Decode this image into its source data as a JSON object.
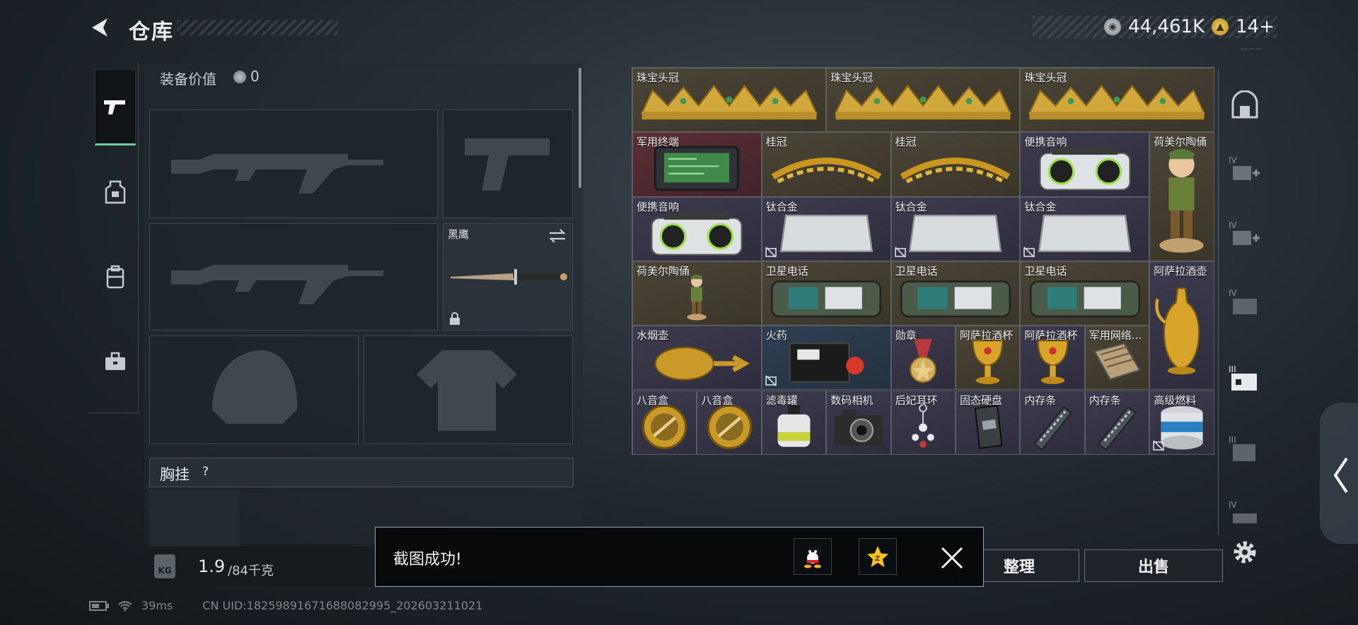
{
  "header": {
    "title": "仓库",
    "currency_silver": "44,461K",
    "currency_gold": "14+"
  },
  "version_text": "———",
  "equipment": {
    "value_label": "装备价值",
    "value": "0",
    "knife_slot_label": "黑鹰",
    "chest_label": "胸挂",
    "chest_help": "?",
    "weight_icon_text": "KG",
    "weight_current": "1.9",
    "weight_max": "/84千克"
  },
  "grid_items": [
    {
      "name": "珠宝头冠",
      "rarity": "gold",
      "icon": "crown-icon"
    },
    {
      "name": "珠宝头冠",
      "rarity": "gold",
      "icon": "crown-icon"
    },
    {
      "name": "珠宝头冠",
      "rarity": "gold",
      "icon": "crown-icon"
    },
    {
      "name": "军用终端",
      "rarity": "red",
      "icon": "terminal-icon"
    },
    {
      "name": "桂冠",
      "rarity": "gold",
      "icon": "laurel-icon"
    },
    {
      "name": "桂冠",
      "rarity": "gold",
      "icon": "laurel-icon"
    },
    {
      "name": "便携音响",
      "rarity": "purple",
      "icon": "speaker-icon"
    },
    {
      "name": "荷美尔陶俑",
      "rarity": "gold",
      "icon": "figurine-icon"
    },
    {
      "name": "便携音响",
      "rarity": "purple",
      "icon": "speaker-icon"
    },
    {
      "name": "钛合金",
      "rarity": "purple",
      "icon": "alloy-icon"
    },
    {
      "name": "钛合金",
      "rarity": "purple",
      "icon": "alloy-icon"
    },
    {
      "name": "钛合金",
      "rarity": "purple",
      "icon": "alloy-icon"
    },
    {
      "name": "荷美尔陶俑",
      "rarity": "gold",
      "icon": "figurine-icon"
    },
    {
      "name": "卫星电话",
      "rarity": "gold",
      "icon": "satphone-icon"
    },
    {
      "name": "卫星电话",
      "rarity": "gold",
      "icon": "satphone-icon"
    },
    {
      "name": "卫星电话",
      "rarity": "gold",
      "icon": "satphone-icon"
    },
    {
      "name": "阿萨拉酒壶",
      "rarity": "purple",
      "icon": "ewer-icon"
    },
    {
      "name": "水烟壶",
      "rarity": "purple",
      "icon": "hookah-icon"
    },
    {
      "name": "火药",
      "rarity": "blue",
      "icon": "gunpowder-icon"
    },
    {
      "name": "勋章",
      "rarity": "purple",
      "icon": "medal-icon"
    },
    {
      "name": "阿萨拉酒杯",
      "rarity": "gold",
      "icon": "goblet-icon"
    },
    {
      "name": "阿萨拉酒杯",
      "rarity": "purple",
      "icon": "goblet-icon"
    },
    {
      "name": "军用网络...",
      "rarity": "gold",
      "icon": "network-module-icon"
    },
    {
      "name": "八音盒",
      "rarity": "purple",
      "icon": "music-box-icon"
    },
    {
      "name": "八音盒",
      "rarity": "purple",
      "icon": "music-box-icon"
    },
    {
      "name": "滤毒罐",
      "rarity": "purple",
      "icon": "filter-canister-icon"
    },
    {
      "name": "数码相机",
      "rarity": "purple",
      "icon": "camera-icon"
    },
    {
      "name": "后妃耳环",
      "rarity": "purple",
      "icon": "earring-icon"
    },
    {
      "name": "固态硬盘",
      "rarity": "purple",
      "icon": "ssd-icon"
    },
    {
      "name": "内存条",
      "rarity": "purple",
      "icon": "ram-icon"
    },
    {
      "name": "内存条",
      "rarity": "purple",
      "icon": "ram-icon"
    },
    {
      "name": "高级燃料",
      "rarity": "purple",
      "icon": "fuel-can-icon"
    }
  ],
  "actions": {
    "organize_label": "整理",
    "sell_label": "出售"
  },
  "toast": {
    "message": "截图成功!"
  },
  "status_bar": {
    "ping": "39ms",
    "uid": "CN UID:18259891671688082995_202603211021"
  },
  "colors": {
    "accent_green": "#6ed0a0",
    "rarity_gold": "#4b4537",
    "rarity_purple": "#3d3a4f",
    "rarity_red": "#5b2e36",
    "rarity_blue": "#2f3e52"
  }
}
